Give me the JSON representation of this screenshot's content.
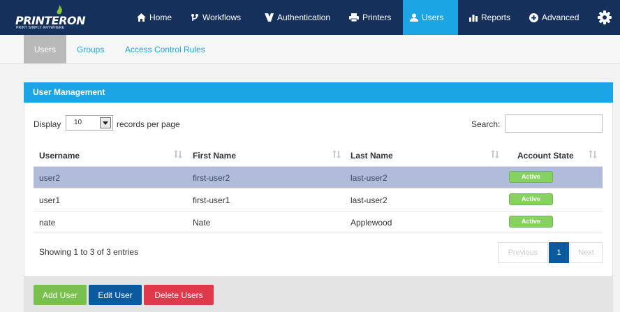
{
  "brand": {
    "name": "PRINTERON",
    "tagline": "PRINT SIMPLY ANYWHERE"
  },
  "nav": {
    "items": [
      {
        "label": "Home",
        "icon": "home-icon"
      },
      {
        "label": "Workflows",
        "icon": "workflow-icon"
      },
      {
        "label": "Authentication",
        "icon": "key-icon"
      },
      {
        "label": "Printers",
        "icon": "printer-icon"
      },
      {
        "label": "Users",
        "icon": "user-icon",
        "active": true
      },
      {
        "label": "Reports",
        "icon": "bar-chart-icon"
      },
      {
        "label": "Advanced",
        "icon": "plus-circle-icon"
      }
    ],
    "settings_icon": "gear-icon"
  },
  "subnav": {
    "items": [
      {
        "label": "Users",
        "active": true
      },
      {
        "label": "Groups"
      },
      {
        "label": "Access Control Rules"
      }
    ]
  },
  "panel": {
    "title": "User Management",
    "display_label": "Display",
    "page_size": "10",
    "records_label": "records per page",
    "search_label": "Search:",
    "search_value": "",
    "columns": [
      "Username",
      "First Name",
      "Last Name",
      "Account State"
    ],
    "rows": [
      {
        "username": "user2",
        "first_name": "first-user2",
        "last_name": "last-user2",
        "state": "Active",
        "selected": true
      },
      {
        "username": "user1",
        "first_name": "first-user1",
        "last_name": "last-user2",
        "state": "Active"
      },
      {
        "username": "nate",
        "first_name": "Nate",
        "last_name": "Applewood",
        "state": "Active"
      }
    ],
    "info": "Showing 1 to 3 of 3 entries",
    "pagination": {
      "previous": "Previous",
      "current": "1",
      "next": "Next"
    }
  },
  "actions": {
    "add": "Add User",
    "edit": "Edit User",
    "delete": "Delete Users"
  },
  "colors": {
    "nav_bg": "#16305c",
    "accent": "#1ca5e4",
    "selected_row": "#b0bcd9",
    "active_badge": "#87d163",
    "edit_button": "#0b5aa0",
    "delete_button": "#e0394c"
  }
}
